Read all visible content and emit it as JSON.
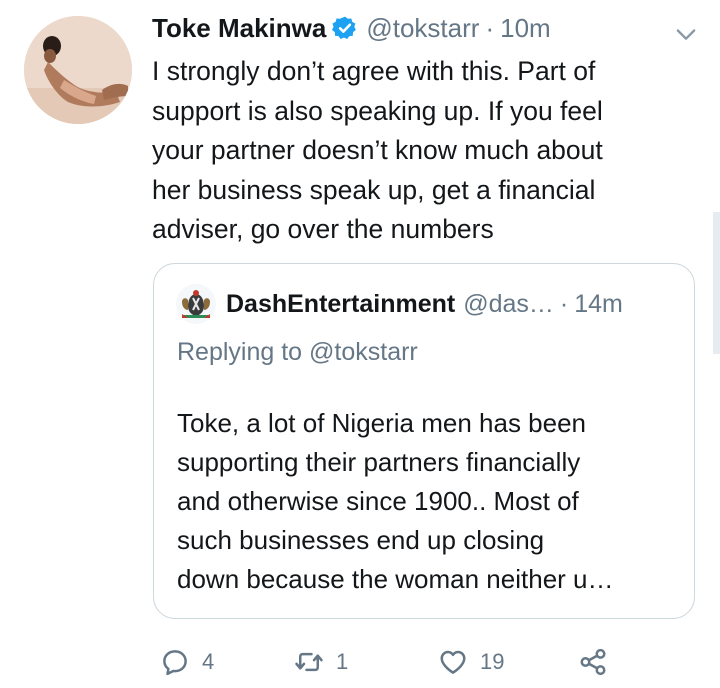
{
  "tweet": {
    "author_name": "Toke Makinwa",
    "author_handle": "@tokstarr",
    "separator": "·",
    "time": "10m",
    "avatar_icon": "profile-photo",
    "verified_icon": "verified-badge-icon",
    "text_lines": [
      "I strongly don’t agree with this. Part of",
      "support is also speaking up. If you feel",
      "your partner doesn’t know much about",
      "her business speak up, get a financial",
      "adviser, go over the numbers"
    ]
  },
  "quoted_tweet": {
    "author_name": "DashEntertainment",
    "author_handle": "@das…",
    "separator": "·",
    "time": "14m",
    "avatar_icon": "coat-of-arms-avatar",
    "replying_to": "Replying to @tokstarr",
    "text_lines": [
      "Toke, a lot of Nigeria men has been",
      "supporting their partners financially",
      "and otherwise since 1900.. Most of",
      "such businesses end up closing",
      "down because the woman neither u…"
    ]
  },
  "actions": {
    "reply_count": "4",
    "retweet_count": "1",
    "like_count": "19"
  },
  "colors": {
    "text_primary": "#14171a",
    "text_secondary": "#657786",
    "verified_blue": "#1da1f2",
    "border": "#ccd6dd"
  }
}
